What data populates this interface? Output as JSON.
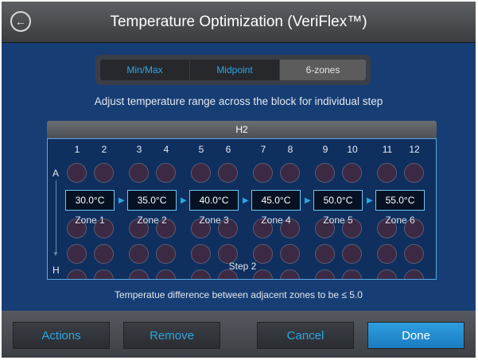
{
  "header": {
    "back_icon": "back-arrow-icon",
    "title": "Temperature Optimization (VeriFlex™)"
  },
  "tabs": [
    {
      "label": "Min/Max",
      "selected": false
    },
    {
      "label": "Midpoint",
      "selected": false
    },
    {
      "label": "6-zones",
      "selected": true
    }
  ],
  "instruction": "Adjust temperature range across the block for individual step",
  "block": {
    "title": "H2",
    "columns": [
      "1",
      "2",
      "3",
      "4",
      "5",
      "6",
      "7",
      "8",
      "9",
      "10",
      "11",
      "12"
    ],
    "row_top": "A",
    "row_bottom": "H",
    "zones": [
      {
        "temp": "30.0°C",
        "label": "Zone 1"
      },
      {
        "temp": "35.0°C",
        "label": "Zone 2"
      },
      {
        "temp": "40.0°C",
        "label": "Zone 3"
      },
      {
        "temp": "45.0°C",
        "label": "Zone 4"
      },
      {
        "temp": "50.0°C",
        "label": "Zone 5"
      },
      {
        "temp": "55.0°C",
        "label": "Zone 6"
      }
    ],
    "step": "Step 2"
  },
  "note": "Temperatue difference between adjacent zones to be ≤ 5.0",
  "footer": {
    "actions": "Actions",
    "remove": "Remove",
    "cancel": "Cancel",
    "done": "Done"
  },
  "colors": {
    "background": "#173e74",
    "accent": "#2aa7e3",
    "done_button": "#1f88cc"
  }
}
